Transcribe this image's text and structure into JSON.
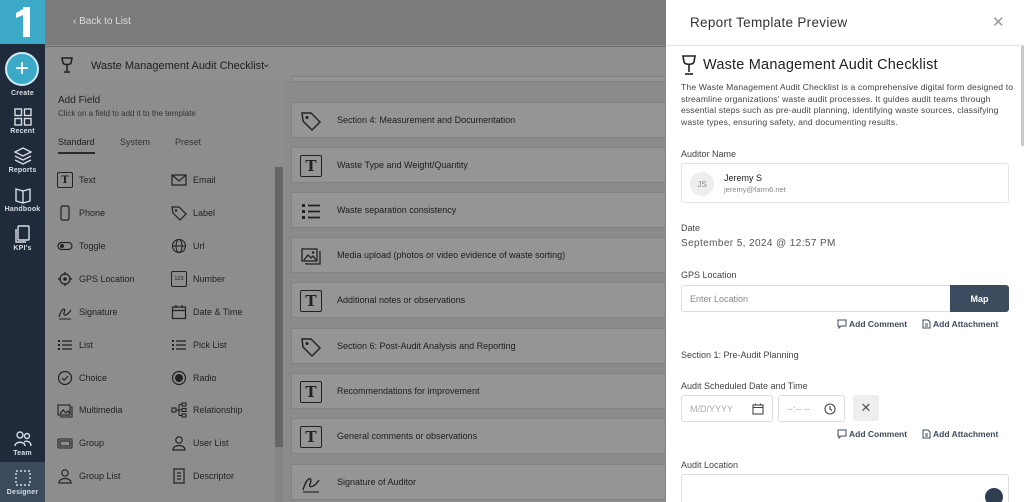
{
  "nav": {
    "create_label": "Create",
    "items": [
      {
        "label": "Recent",
        "icon": "grid-icon"
      },
      {
        "label": "Reports",
        "icon": "layers-icon"
      },
      {
        "label": "Handbook",
        "icon": "book-icon"
      },
      {
        "label": "KPI's",
        "icon": "document-icon"
      }
    ],
    "team_label": "Team",
    "designer_label": "Designer"
  },
  "header": {
    "back_label": "Back to List",
    "template_title": "Waste Management Audit Checklist"
  },
  "field_panel": {
    "title": "Add Field",
    "subtitle": "Click on a field to add it to the template",
    "tabs": [
      "Standard",
      "System",
      "Preset"
    ],
    "active_tab": "Standard",
    "fields_left": [
      "Text",
      "Phone",
      "Toggle",
      "GPS Location",
      "Signature",
      "List",
      "Choice",
      "Multimedia",
      "Group",
      "Group List"
    ],
    "fields_right": [
      "Email",
      "Label",
      "Url",
      "Number",
      "Date & Time",
      "Pick List",
      "Radio",
      "Relationship",
      "User List",
      "Descriptor"
    ]
  },
  "canvas": {
    "items": [
      {
        "label": "Section 4: Measurement and Documentation",
        "icon": "tag-icon"
      },
      {
        "label": "Waste Type and Weight/Quantity",
        "icon": "text-icon"
      },
      {
        "label": "Waste separation consistency",
        "icon": "list-icon"
      },
      {
        "label": "Media upload (photos or video evidence of waste sorting)",
        "icon": "image-icon"
      },
      {
        "label": "Additional notes or observations",
        "icon": "text-icon"
      },
      {
        "label": "Section 6: Post-Audit Analysis and Reporting",
        "icon": "tag-icon"
      },
      {
        "label": "Recommendations for improvement",
        "icon": "text-icon"
      },
      {
        "label": "General comments or observations",
        "icon": "text-icon"
      },
      {
        "label": "Signature of Auditor",
        "icon": "signature-icon"
      }
    ]
  },
  "preview": {
    "title": "Report Template Preview",
    "form_title": "Waste Management Audit Checklist",
    "description": "The Waste Management Audit Checklist is a comprehensive digital form designed to streamline organizations' waste audit processes. It guides audit teams through essential steps such as pre-audit planning, identifying waste sources, classifying waste types, ensuring safety, and documenting results.",
    "auditor_label": "Auditor Name",
    "auditor": {
      "initials": "JS",
      "name": "Jeremy S",
      "email": "jeremy@farm6.net"
    },
    "date_label": "Date",
    "date_value": "September 5, 2024 @ 12:57 PM",
    "gps_label": "GPS Location",
    "gps_placeholder": "Enter Location",
    "map_button": "Map",
    "add_comment": "Add Comment",
    "add_attachment": "Add Attachment",
    "section1": "Section 1: Pre-Audit Planning",
    "scheduled_label": "Audit Scheduled Date and Time",
    "date_placeholder": "M/D/YYYY",
    "time_placeholder": "--:-- --",
    "location_label": "Audit Location"
  }
}
